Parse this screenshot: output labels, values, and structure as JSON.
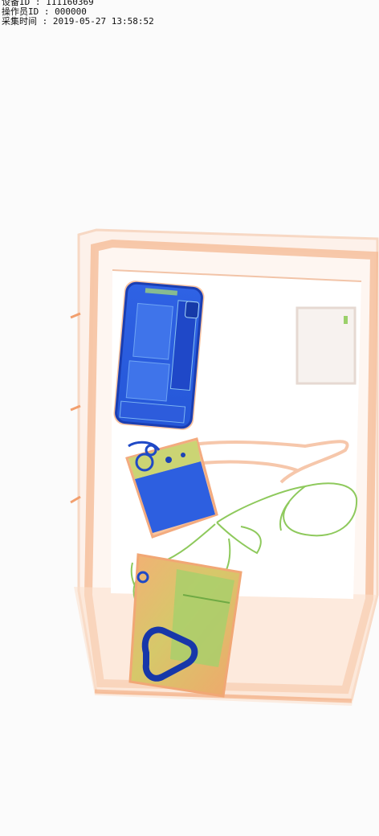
{
  "overlay": {
    "device_id": "设备ID : 111160369",
    "operator_id": "操作员ID : 000000",
    "capture_time": "采集时间 : 2019-05-27 13:58:52"
  },
  "scan": {
    "contents": [
      "tray",
      "smartphone",
      "power-bank",
      "earphone-cable",
      "charger-cable",
      "wallet",
      "carabiner",
      "paper-card"
    ],
    "colors": {
      "background": "#fbfbfb",
      "organic_orange": "#f2a374",
      "inorganic_green": "#8fc35a",
      "metal_blue": "#1f4fd6"
    }
  }
}
